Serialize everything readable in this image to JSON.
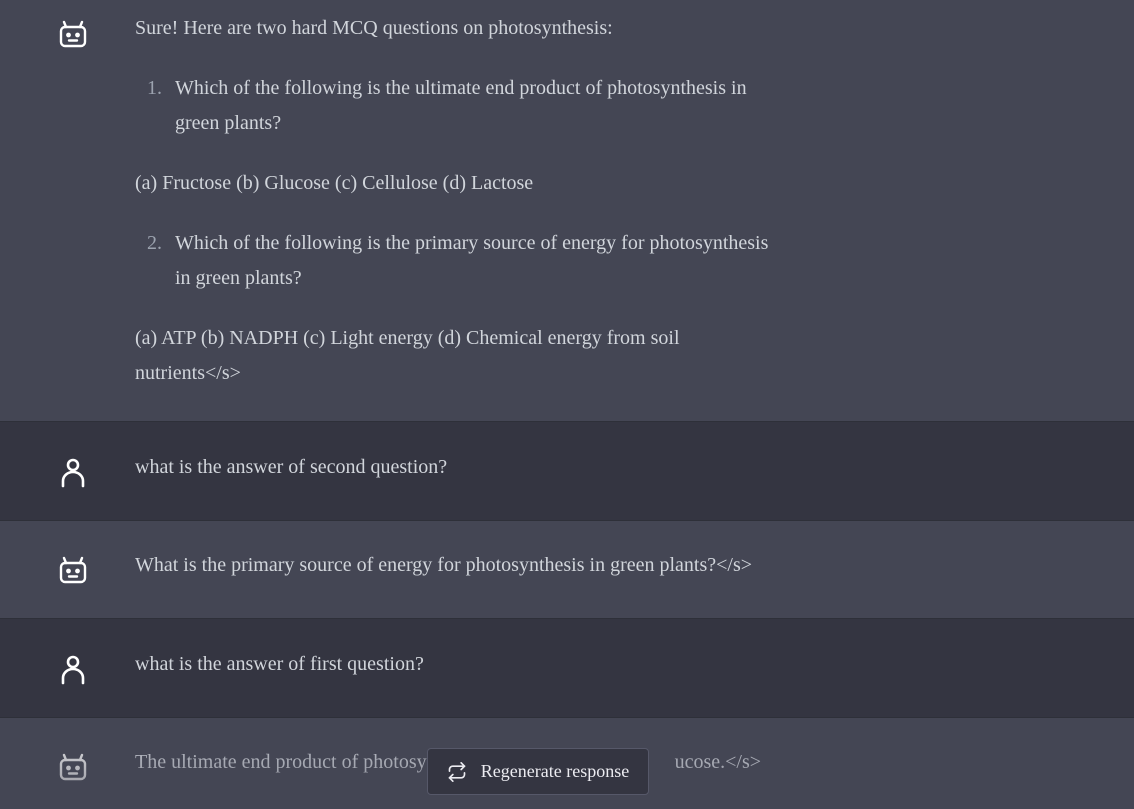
{
  "messages": [
    {
      "role": "bot",
      "intro": "Sure! Here are two hard MCQ questions on photosynthesis:",
      "q1_num": "1.",
      "q1_line1": "Which of the following is the ultimate end product of photosynthesis in",
      "q1_line2": "green plants?",
      "q1_options": "(a) Fructose (b) Glucose (c) Cellulose (d) Lactose",
      "q2_num": "2.",
      "q2_line1": "Which of the following is the primary source of energy for photosynthesis",
      "q2_line2": "in green plants?",
      "q2_options_line1": "(a) ATP (b) NADPH (c) Light energy (d) Chemical energy from soil",
      "q2_options_line2": "nutrients</s>"
    },
    {
      "role": "user",
      "text": "what is the answer of second question?"
    },
    {
      "role": "bot",
      "text": "What is the primary source of energy for photosynthesis in green plants?</s>"
    },
    {
      "role": "user",
      "text": "what is the answer of first question?"
    },
    {
      "role": "bot",
      "text_visible_left": "The ultimate end product of photosy",
      "text_visible_right": "ucose.</s>"
    }
  ],
  "regenerate_label": "Regenerate response",
  "icons": {
    "bot": "robot-icon",
    "user": "user-icon",
    "regenerate": "refresh-icon"
  },
  "colors": {
    "bot_bg": "#444654",
    "user_bg": "#343541",
    "text": "#d1d5db"
  }
}
